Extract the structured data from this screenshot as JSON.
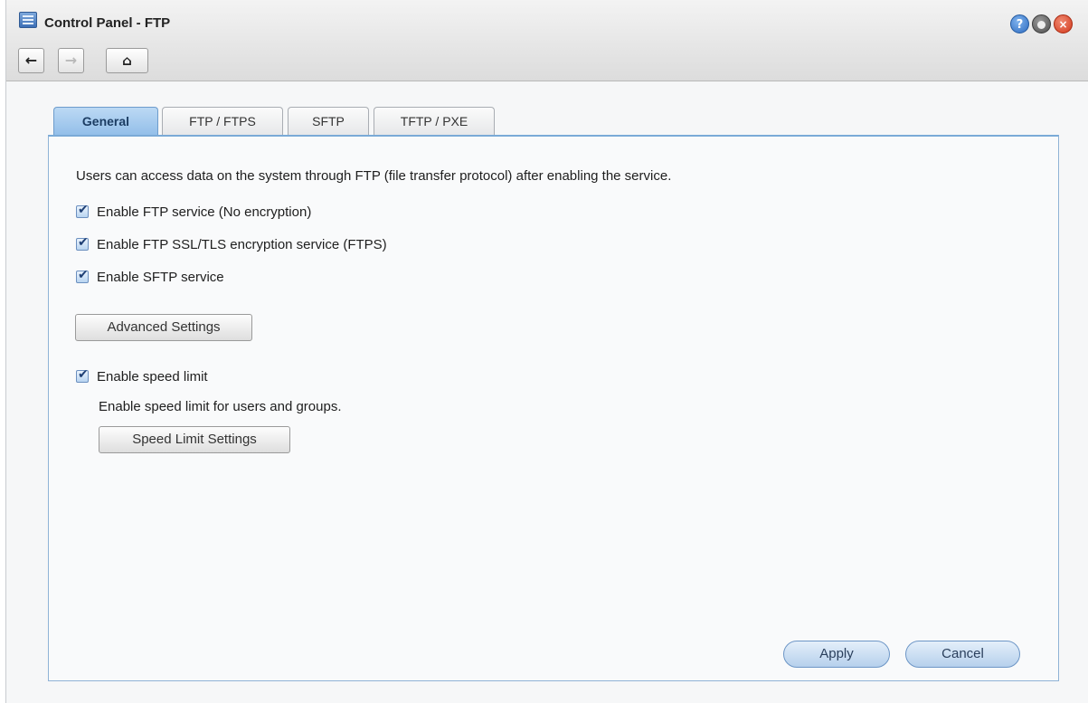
{
  "window": {
    "title": "Control Panel - FTP",
    "help_glyph": "?",
    "close_glyph": "×"
  },
  "nav": {
    "back_glyph": "←",
    "forward_glyph": "→",
    "home_glyph": "⌂"
  },
  "tabs": [
    {
      "label": "General",
      "active": true
    },
    {
      "label": "FTP / FTPS",
      "active": false
    },
    {
      "label": "SFTP",
      "active": false
    },
    {
      "label": "TFTP / PXE",
      "active": false
    }
  ],
  "general": {
    "description": "Users can access data on the system through FTP (file transfer protocol) after enabling the service.",
    "options": [
      {
        "label": "Enable FTP service (No encryption)",
        "checked": true
      },
      {
        "label": "Enable FTP SSL/TLS encryption service (FTPS)",
        "checked": true
      },
      {
        "label": "Enable SFTP service",
        "checked": true
      }
    ],
    "advanced_settings_label": "Advanced Settings",
    "speed_limit": {
      "label": "Enable speed limit",
      "checked": true,
      "description": "Enable speed limit for users and groups.",
      "button_label": "Speed Limit Settings"
    }
  },
  "footer": {
    "apply_label": "Apply",
    "cancel_label": "Cancel"
  },
  "colors": {
    "accent": "#8fbce8",
    "close": "#d2391c",
    "help": "#2f6cc0"
  }
}
